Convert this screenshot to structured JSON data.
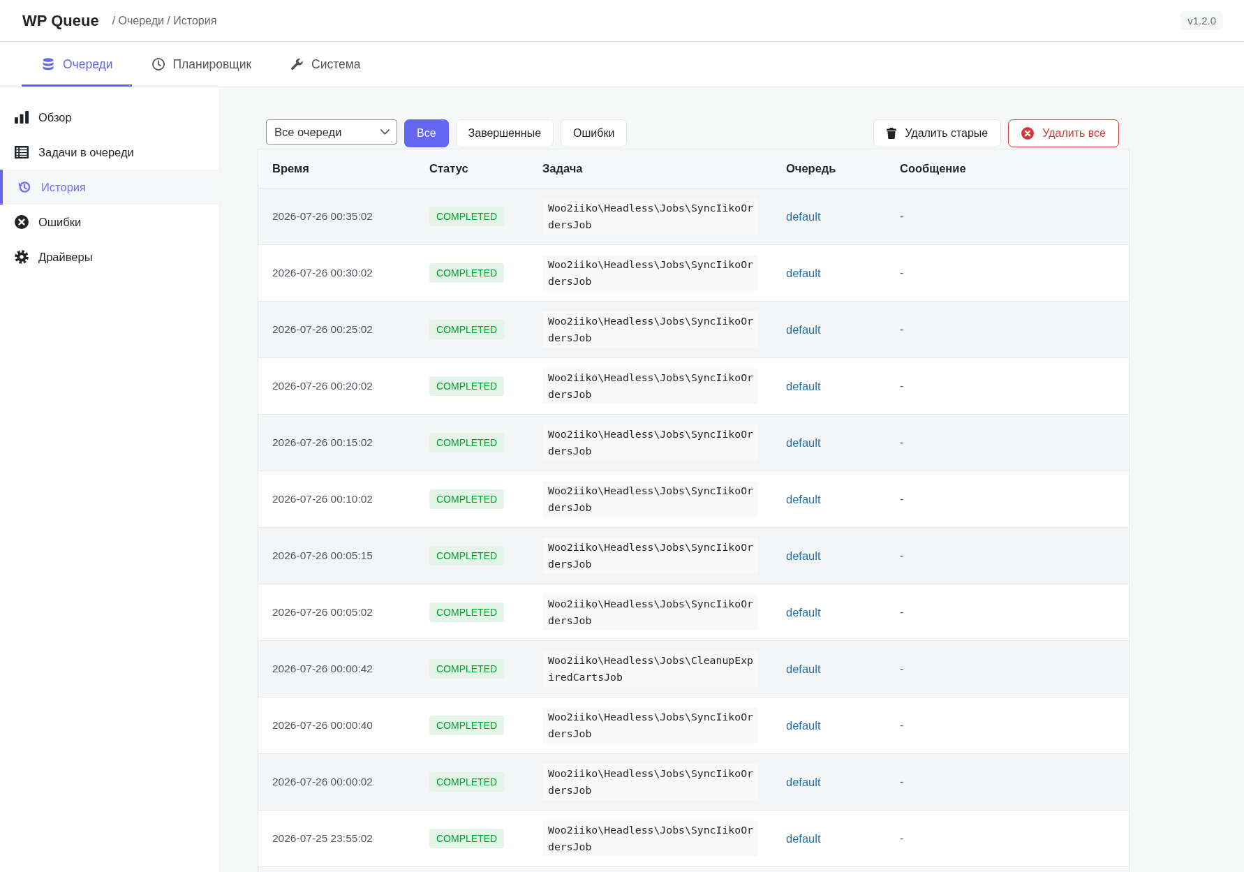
{
  "header": {
    "title": "WP Queue",
    "breadcrumb": "/ Очереди / История",
    "version": "v1.2.0"
  },
  "tabs": [
    {
      "label": "Очереди",
      "selected": true
    },
    {
      "label": "Планировщик",
      "selected": false
    },
    {
      "label": "Система",
      "selected": false
    }
  ],
  "sidebar": {
    "items": [
      {
        "label": "Обзор",
        "selected": false
      },
      {
        "label": "Задачи в очереди",
        "selected": false
      },
      {
        "label": "История",
        "selected": true
      },
      {
        "label": "Ошибки",
        "selected": false
      },
      {
        "label": "Драйверы",
        "selected": false
      }
    ]
  },
  "filters": {
    "queue_select": {
      "value": "Все очереди"
    },
    "status_buttons": [
      {
        "label": "Все",
        "selected": true
      },
      {
        "label": "Завершенные",
        "selected": false
      },
      {
        "label": "Ошибки",
        "selected": false
      }
    ],
    "actions": [
      {
        "label": "Удалить старые",
        "kind": "neutral"
      },
      {
        "label": "Удалить все",
        "kind": "danger"
      }
    ]
  },
  "table": {
    "columns": [
      "Время",
      "Статус",
      "Задача",
      "Очередь",
      "Сообщение"
    ],
    "rows": [
      {
        "time": "2026-07-26 00:35:02",
        "status": "COMPLETED",
        "job": "Woo2iiko\\Headless\\Jobs\\SyncIikoOrdersJob",
        "queue": "default",
        "message": "-"
      },
      {
        "time": "2026-07-26 00:30:02",
        "status": "COMPLETED",
        "job": "Woo2iiko\\Headless\\Jobs\\SyncIikoOrdersJob",
        "queue": "default",
        "message": "-"
      },
      {
        "time": "2026-07-26 00:25:02",
        "status": "COMPLETED",
        "job": "Woo2iiko\\Headless\\Jobs\\SyncIikoOrdersJob",
        "queue": "default",
        "message": "-"
      },
      {
        "time": "2026-07-26 00:20:02",
        "status": "COMPLETED",
        "job": "Woo2iiko\\Headless\\Jobs\\SyncIikoOrdersJob",
        "queue": "default",
        "message": "-"
      },
      {
        "time": "2026-07-26 00:15:02",
        "status": "COMPLETED",
        "job": "Woo2iiko\\Headless\\Jobs\\SyncIikoOrdersJob",
        "queue": "default",
        "message": "-"
      },
      {
        "time": "2026-07-26 00:10:02",
        "status": "COMPLETED",
        "job": "Woo2iiko\\Headless\\Jobs\\SyncIikoOrdersJob",
        "queue": "default",
        "message": "-"
      },
      {
        "time": "2026-07-26 00:05:15",
        "status": "COMPLETED",
        "job": "Woo2iiko\\Headless\\Jobs\\SyncIikoOrdersJob",
        "queue": "default",
        "message": "-"
      },
      {
        "time": "2026-07-26 00:05:02",
        "status": "COMPLETED",
        "job": "Woo2iiko\\Headless\\Jobs\\SyncIikoOrdersJob",
        "queue": "default",
        "message": "-"
      },
      {
        "time": "2026-07-26 00:00:42",
        "status": "COMPLETED",
        "job": "Woo2iiko\\Headless\\Jobs\\CleanupExpiredCartsJob",
        "queue": "default",
        "message": "-"
      },
      {
        "time": "2026-07-26 00:00:40",
        "status": "COMPLETED",
        "job": "Woo2iiko\\Headless\\Jobs\\SyncIikoOrdersJob",
        "queue": "default",
        "message": "-"
      },
      {
        "time": "2026-07-26 00:00:02",
        "status": "COMPLETED",
        "job": "Woo2iiko\\Headless\\Jobs\\SyncIikoOrdersJob",
        "queue": "default",
        "message": "-"
      },
      {
        "time": "2026-07-25 23:55:02",
        "status": "COMPLETED",
        "job": "Woo2iiko\\Headless\\Jobs\\SyncIikoOrdersJob",
        "queue": "default",
        "message": "-"
      }
    ]
  }
}
